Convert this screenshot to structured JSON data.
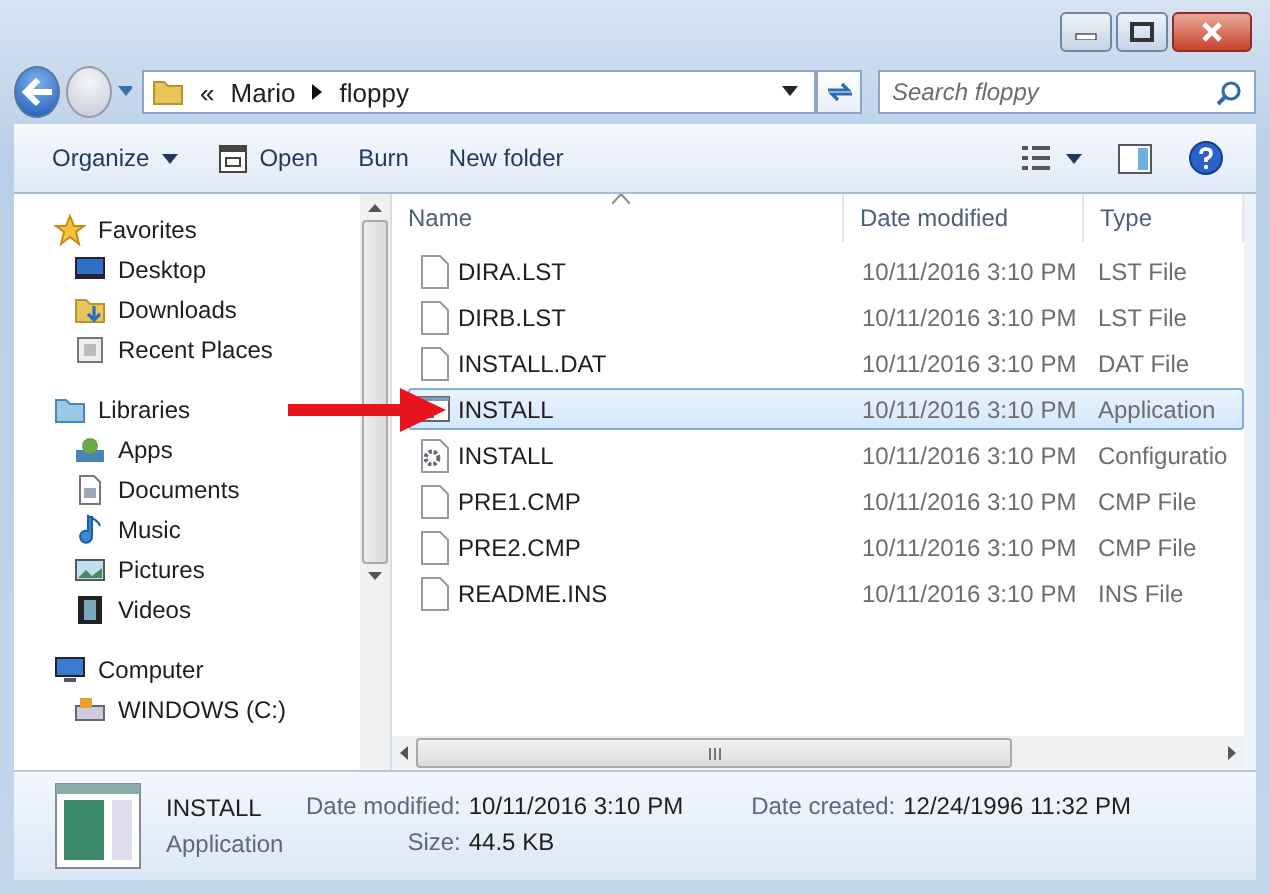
{
  "address": {
    "overflow": "«",
    "path": [
      "Mario",
      "floppy"
    ]
  },
  "search": {
    "placeholder": "Search floppy"
  },
  "toolbar": [
    {
      "label": "Organize",
      "kind": "menu"
    },
    {
      "label": "Open",
      "kind": "open"
    },
    {
      "label": "Burn",
      "kind": "plain"
    },
    {
      "label": "New folder",
      "kind": "plain"
    }
  ],
  "nav": [
    {
      "label": "Favorites",
      "kind": "star",
      "children": [
        {
          "label": "Desktop",
          "kind": "monitor"
        },
        {
          "label": "Downloads",
          "kind": "folder"
        },
        {
          "label": "Recent Places",
          "kind": "recent"
        }
      ]
    },
    {
      "label": "Libraries",
      "kind": "folder",
      "children": [
        {
          "label": "Apps",
          "kind": "apps"
        },
        {
          "label": "Documents",
          "kind": "document"
        },
        {
          "label": "Music",
          "kind": "music"
        },
        {
          "label": "Pictures",
          "kind": "picture"
        },
        {
          "label": "Videos",
          "kind": "video"
        }
      ]
    },
    {
      "label": "Computer",
      "kind": "monitor",
      "children": [
        {
          "label": "WINDOWS (C:)",
          "kind": "drive"
        }
      ]
    }
  ],
  "columns": [
    {
      "label": "Name"
    },
    {
      "label": "Date modified"
    },
    {
      "label": "Type"
    }
  ],
  "files": [
    {
      "name": "DIRA.LST",
      "date": "10/11/2016 3:10 PM",
      "type": "LST File",
      "kind": "blank",
      "selected": false
    },
    {
      "name": "DIRB.LST",
      "date": "10/11/2016 3:10 PM",
      "type": "LST File",
      "kind": "blank",
      "selected": false
    },
    {
      "name": "INSTALL.DAT",
      "date": "10/11/2016 3:10 PM",
      "type": "DAT File",
      "kind": "blank",
      "selected": false
    },
    {
      "name": "INSTALL",
      "date": "10/11/2016 3:10 PM",
      "type": "Application",
      "kind": "app",
      "selected": true
    },
    {
      "name": "INSTALL",
      "date": "10/11/2016 3:10 PM",
      "type": "Configuratio",
      "kind": "config",
      "selected": false
    },
    {
      "name": "PRE1.CMP",
      "date": "10/11/2016 3:10 PM",
      "type": "CMP File",
      "kind": "blank",
      "selected": false
    },
    {
      "name": "PRE2.CMP",
      "date": "10/11/2016 3:10 PM",
      "type": "CMP File",
      "kind": "blank",
      "selected": false
    },
    {
      "name": "README.INS",
      "date": "10/11/2016 3:10 PM",
      "type": "INS File",
      "kind": "blank",
      "selected": false
    }
  ],
  "details": {
    "name": "INSTALL",
    "type": "Application",
    "columns": [
      [
        {
          "label": "Date modified:",
          "value": "10/11/2016 3:10 PM"
        },
        {
          "label": "Size:",
          "value": "44.5 KB"
        }
      ],
      [
        {
          "label": "Date created:",
          "value": "12/24/1996 11:32 PM"
        }
      ]
    ]
  }
}
